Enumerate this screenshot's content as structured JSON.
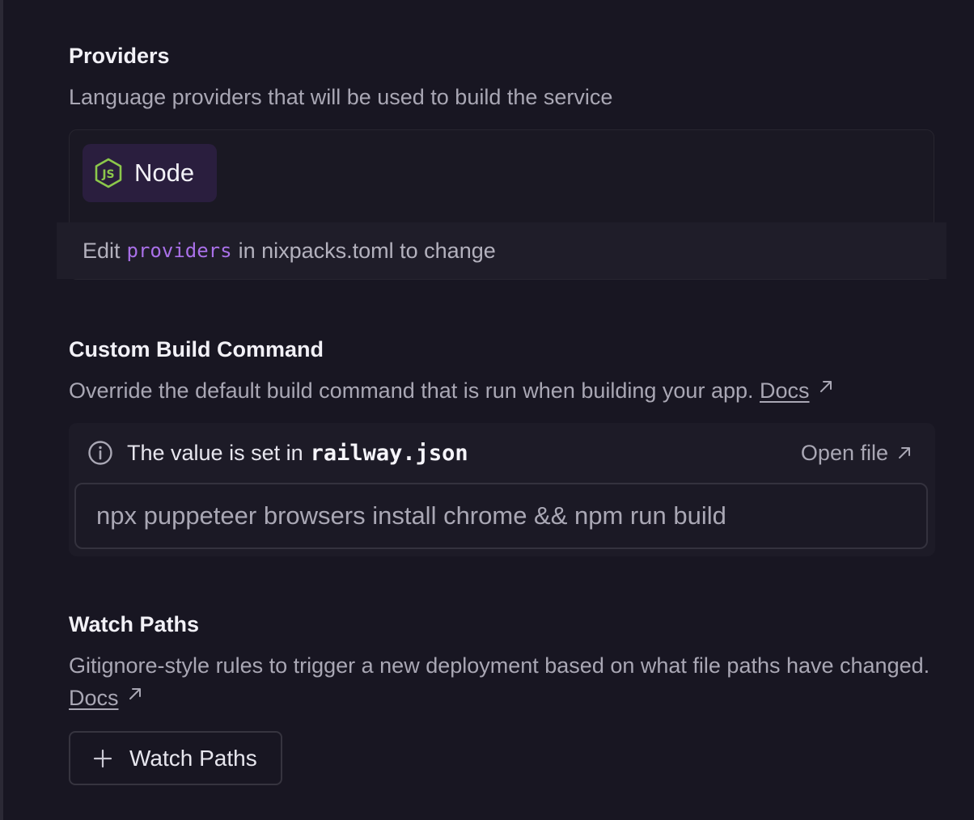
{
  "providers": {
    "title": "Providers",
    "description": "Language providers that will be used to build the service",
    "items": [
      {
        "label": "Node",
        "icon": "nodejs-icon",
        "color": "#8cc84b"
      }
    ],
    "hint_prefix": "Edit",
    "hint_code": "providers",
    "hint_suffix": "in nixpacks.toml to change"
  },
  "build_command": {
    "title": "Custom Build Command",
    "description": "Override the default build command that is run when building your app.",
    "docs_label": "Docs",
    "info_text": "The value is set in",
    "info_file": "railway.json",
    "open_file_label": "Open file",
    "value": "npx puppeteer browsers install chrome && npm run build"
  },
  "watch_paths": {
    "title": "Watch Paths",
    "description": "Gitignore-style rules to trigger a new deployment based on what file paths have changed.",
    "docs_label": "Docs",
    "button_label": "Watch Paths"
  },
  "colors": {
    "background": "#181622",
    "accent_code": "#a970e8",
    "node_green": "#8cc84b"
  }
}
